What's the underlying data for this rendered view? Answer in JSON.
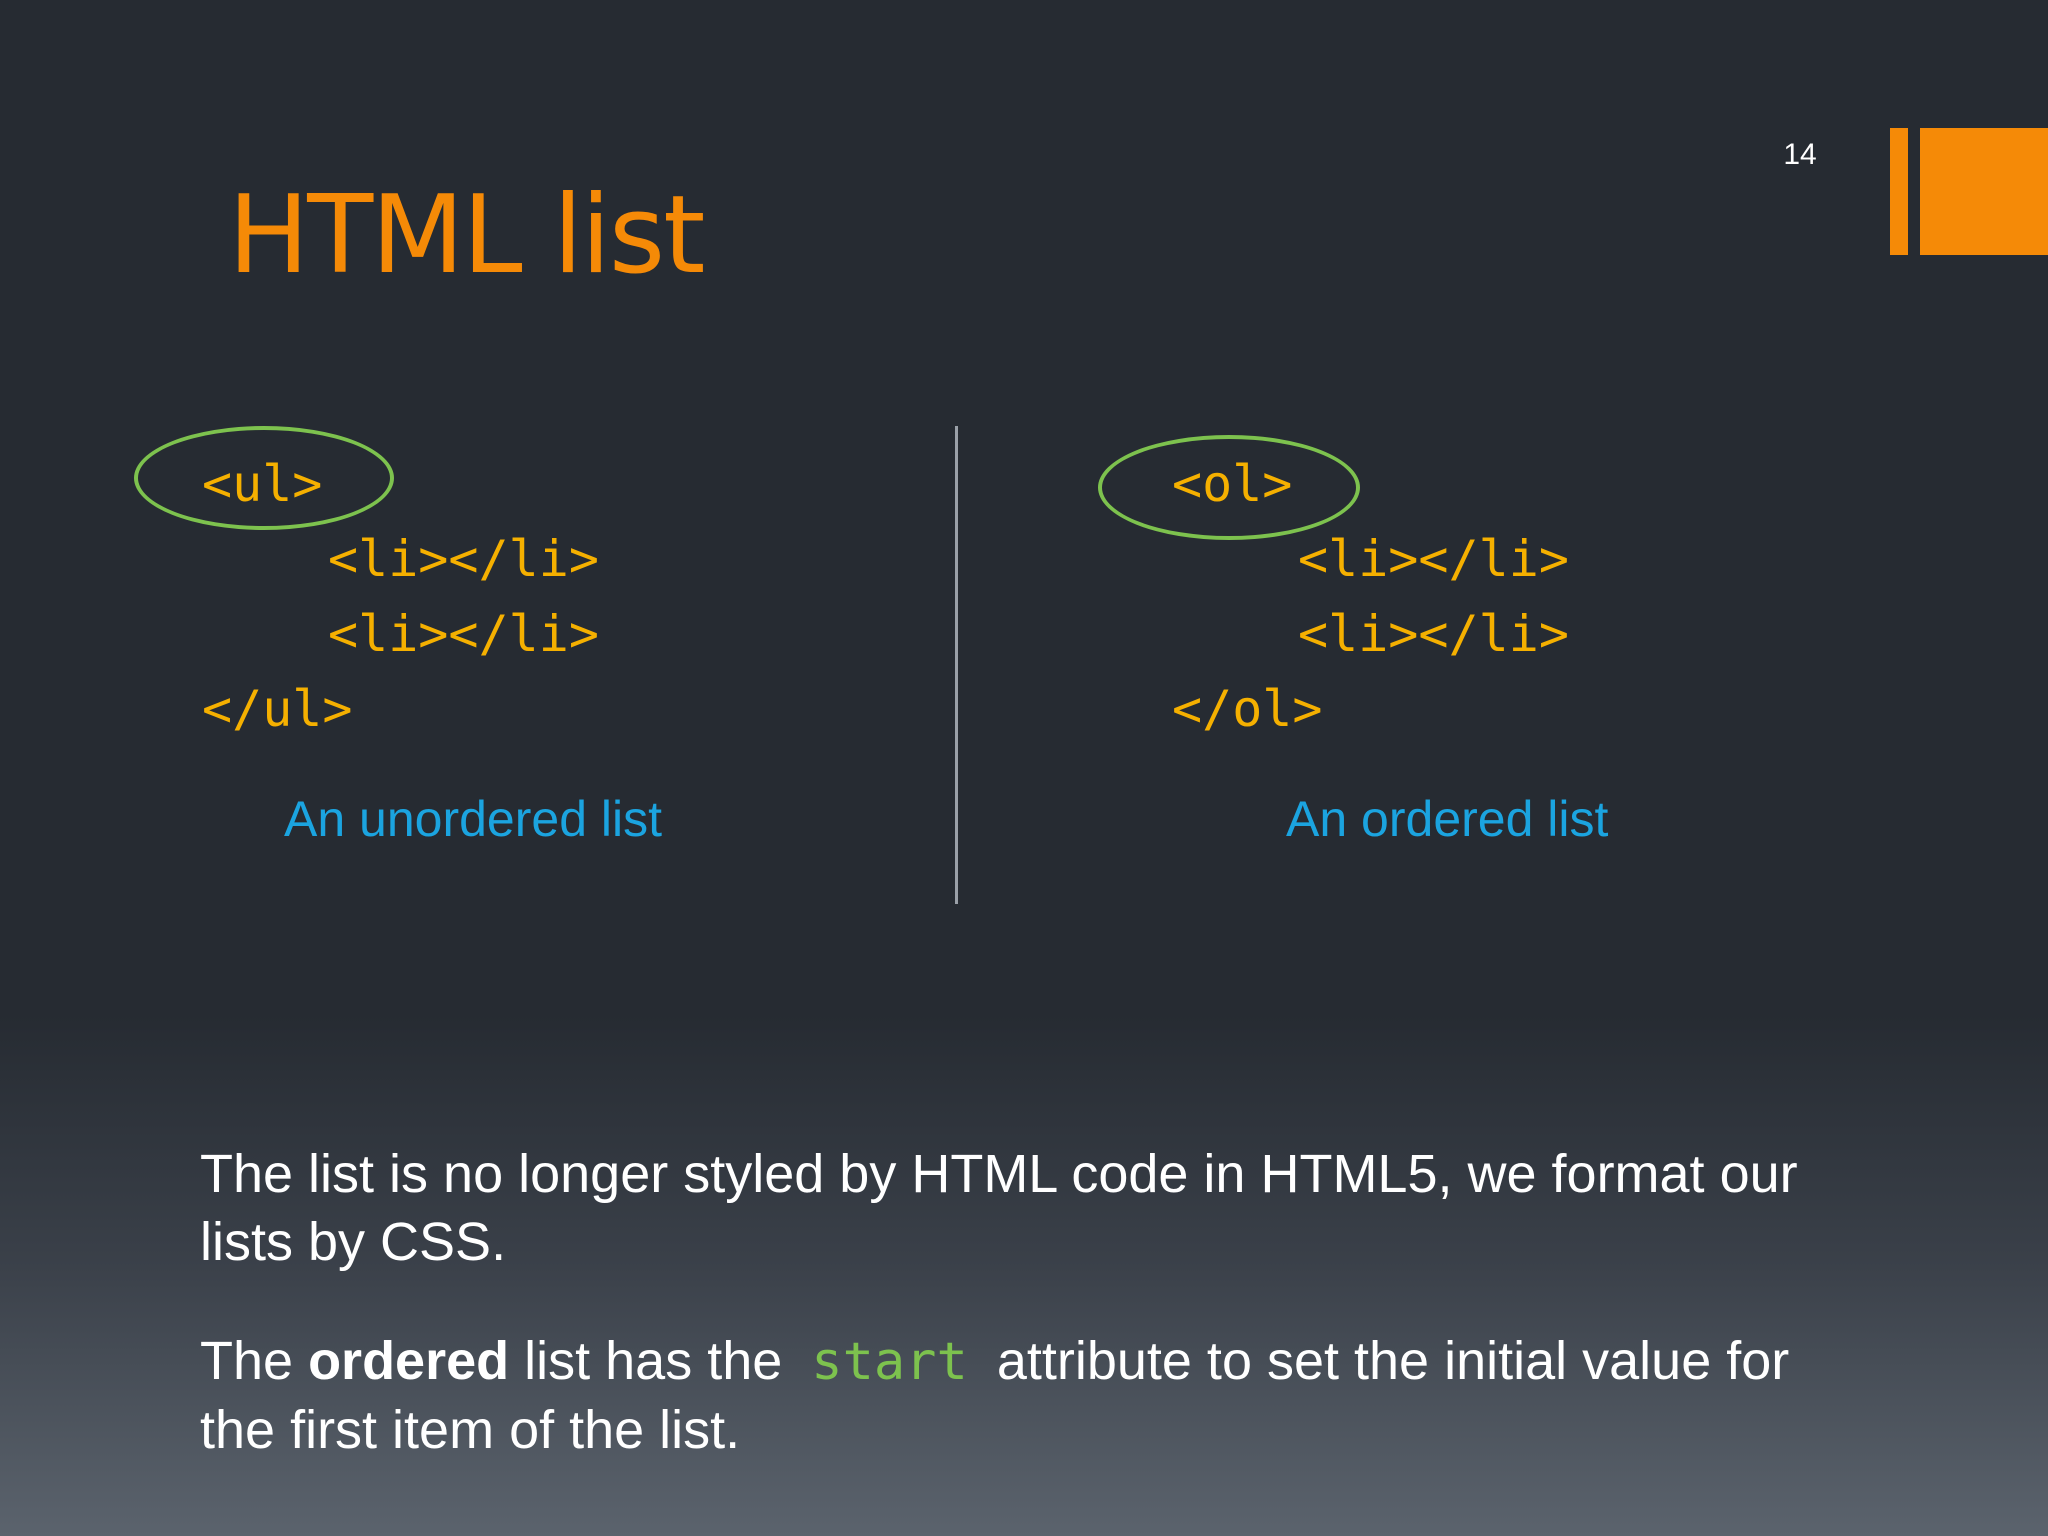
{
  "slide": {
    "number": "14",
    "title": "HTML list",
    "accent_color": "#f58a07"
  },
  "left_panel": {
    "code_lines": [
      "<ul>",
      "<li></li>",
      "<li></li>",
      "</ul>"
    ],
    "caption": "An unordered list"
  },
  "right_panel": {
    "code_lines": [
      "<ol>",
      "<li></li>",
      "<li></li>",
      "</ol>"
    ],
    "caption": "An ordered list"
  },
  "body": {
    "paragraph1": "The list is no longer styled by HTML code in HTML5, we format our lists by CSS.",
    "paragraph2": {
      "part1": "The ",
      "bold": "ordered",
      "part2": " list has the ",
      "code": "start",
      "part3": " attribute to set the initial value for the first item of the list."
    }
  },
  "colors": {
    "code": "#f5b000",
    "caption": "#1ba4e0",
    "highlight_oval": "#7dc24e",
    "text": "#ffffff"
  }
}
